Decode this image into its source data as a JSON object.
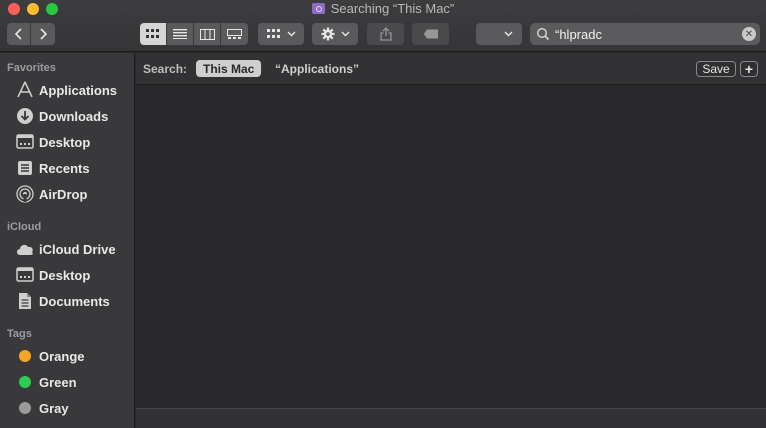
{
  "window": {
    "title": "Searching “This Mac”"
  },
  "toolbar": {
    "back": "‹",
    "forward": "›",
    "view_modes": [
      "icon",
      "list",
      "column",
      "gallery"
    ],
    "search": {
      "value": "“hlpradc",
      "placeholder": "Search"
    }
  },
  "sidebar": {
    "sections": [
      {
        "title": "Favorites",
        "items": [
          {
            "label": "Applications",
            "icon": "applications-icon"
          },
          {
            "label": "Downloads",
            "icon": "downloads-icon"
          },
          {
            "label": "Desktop",
            "icon": "desktop-icon"
          },
          {
            "label": "Recents",
            "icon": "recents-icon"
          },
          {
            "label": "AirDrop",
            "icon": "airdrop-icon"
          }
        ]
      },
      {
        "title": "iCloud",
        "items": [
          {
            "label": "iCloud Drive",
            "icon": "cloud-icon"
          },
          {
            "label": "Desktop",
            "icon": "desktop-icon"
          },
          {
            "label": "Documents",
            "icon": "documents-icon"
          }
        ]
      },
      {
        "title": "Tags",
        "items": [
          {
            "label": "Orange",
            "color": "#f5a623"
          },
          {
            "label": "Green",
            "color": "#2ecc50"
          },
          {
            "label": "Gray",
            "color": "#9a9a9a"
          }
        ]
      }
    ]
  },
  "scope": {
    "label": "Search:",
    "this_mac": "This Mac",
    "applications": "“Applications”",
    "save": "Save",
    "add": "+"
  }
}
